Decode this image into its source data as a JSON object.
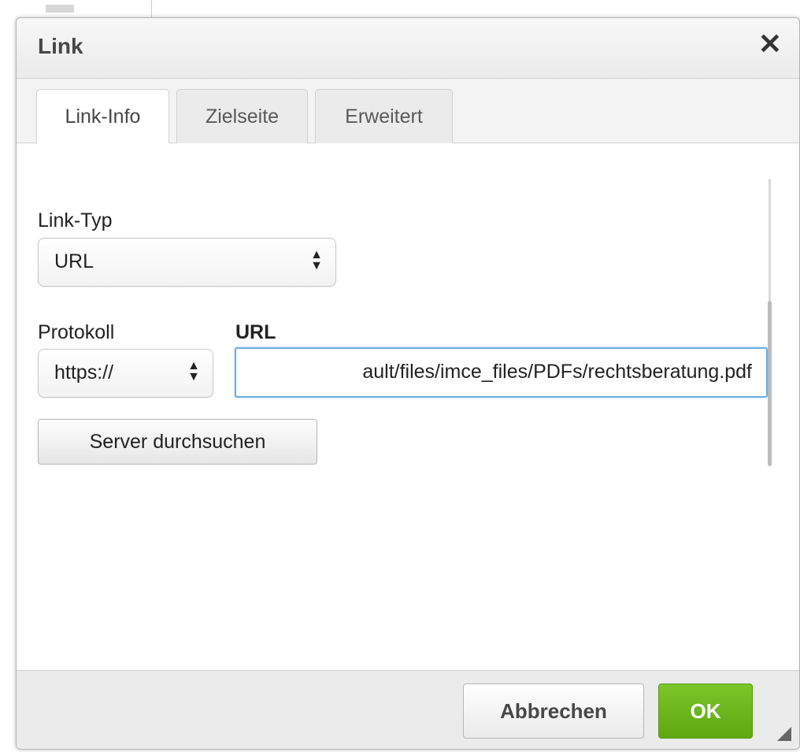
{
  "dialog": {
    "title": "Link",
    "close_glyph": "✕",
    "close_icon": "close-icon"
  },
  "tabs": [
    {
      "label": "Link-Info",
      "active": true
    },
    {
      "label": "Zielseite",
      "active": false
    },
    {
      "label": "Erweitert",
      "active": false
    }
  ],
  "form": {
    "link_type_label": "Link-Typ",
    "link_type_value": "URL",
    "protocol_label": "Protokoll",
    "protocol_value": "https://",
    "url_label": "URL",
    "url_value": "ault/files/imce_files/PDFs/rechtsberatung.pdf",
    "browse_server_label": "Server durchsuchen",
    "select_arrows_icon": "updown-arrows-icon"
  },
  "footer": {
    "cancel_label": "Abbrechen",
    "ok_label": "OK",
    "resize_icon": "resize-handle-icon"
  },
  "colors": {
    "ok_green": "#6bb51d",
    "focus_blue": "#6aaee6"
  }
}
